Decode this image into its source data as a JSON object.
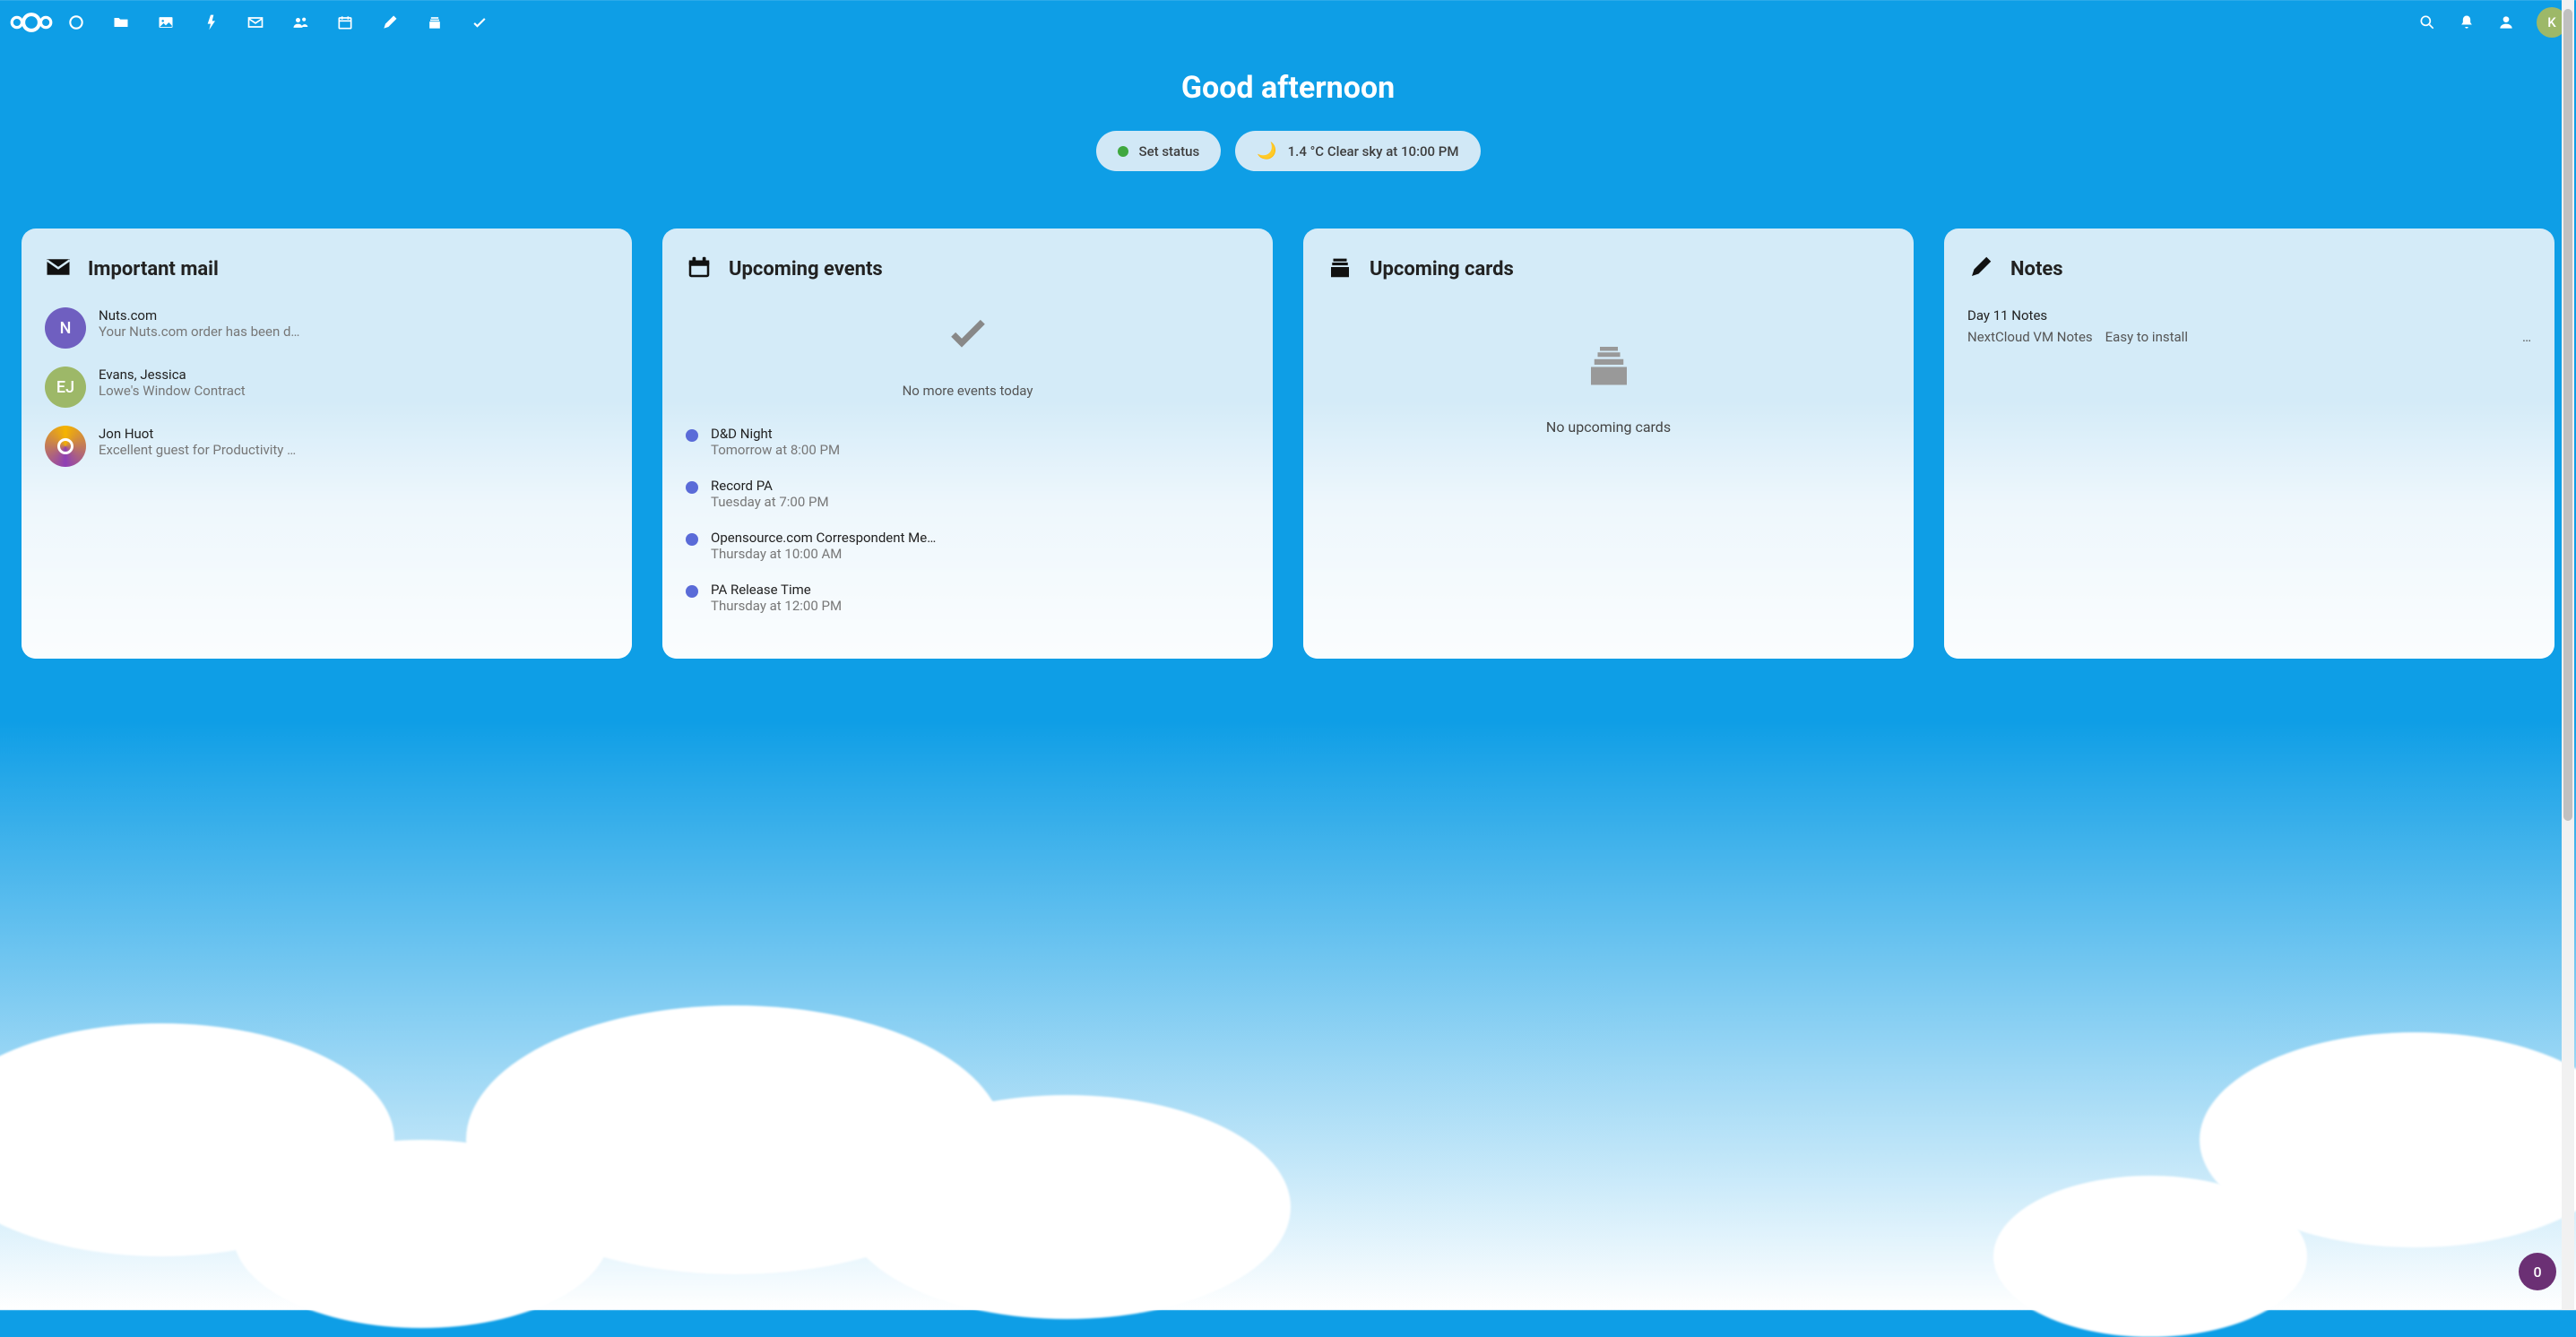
{
  "nav": {
    "avatar_initial": "K"
  },
  "header": {
    "greeting": "Good afternoon",
    "status_chip": "Set status",
    "weather_chip": "1.4 °C Clear sky at 10:00 PM"
  },
  "widgets": {
    "mail": {
      "title": "Important mail",
      "items": [
        {
          "sender": "Nuts.com",
          "subject": "Your Nuts.com order has been d…",
          "initials": "N",
          "color": "#6f5fc0"
        },
        {
          "sender": "Evans, Jessica",
          "subject": "Lowe's Window Contract",
          "initials": "EJ",
          "color": "#9db868"
        },
        {
          "sender": "Jon Huot",
          "subject": "Excellent guest for Productivity …",
          "initials": "",
          "color": "gradient"
        }
      ]
    },
    "events": {
      "title": "Upcoming events",
      "empty_text": "No more events today",
      "items": [
        {
          "title": "D&D Night",
          "time": "Tomorrow at 8:00 PM"
        },
        {
          "title": "Record PA",
          "time": "Tuesday at 7:00 PM"
        },
        {
          "title": "Opensource.com Correspondent Me…",
          "time": "Thursday at 10:00 AM"
        },
        {
          "title": "PA Release Time",
          "time": "Thursday at 12:00 PM"
        }
      ]
    },
    "cards": {
      "title": "Upcoming cards",
      "empty_text": "No upcoming cards"
    },
    "notes": {
      "title": "Notes",
      "item1": "Day 11 Notes",
      "item2a": "NextCloud VM Notes",
      "item2b": "Easy to install",
      "ellipsis": "…"
    }
  },
  "fab": {
    "count": "0"
  }
}
